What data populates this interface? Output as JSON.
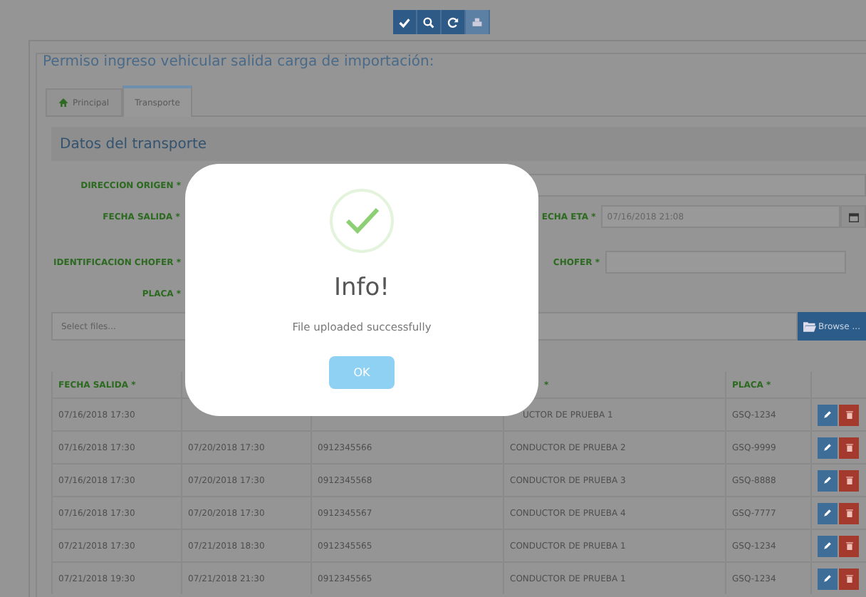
{
  "toolbar": [
    {
      "kind": "check",
      "disabled": false
    },
    {
      "kind": "search",
      "disabled": false
    },
    {
      "kind": "refresh",
      "disabled": false
    },
    {
      "kind": "print",
      "disabled": true
    }
  ],
  "title": "Permiso ingreso vehicular salida carga de importación:",
  "tabs": [
    {
      "label": "Principal",
      "kind": "home",
      "selected": false
    },
    {
      "label": "Transporte",
      "selected": true
    }
  ],
  "section_title": "Datos del transporte",
  "form": {
    "left_labels": [
      "DIRECCION ORIGEN *",
      "FECHA SALIDA *",
      "IDENTIFICACION CHOFER *",
      "PLACA *"
    ],
    "right_fields": [
      {
        "label": "ECHA ETA *",
        "value": "07/16/2018 21:08",
        "kind": "date"
      },
      {
        "label": "CHOFER *",
        "kind": "text"
      }
    ]
  },
  "upload": {
    "placeholder": "Select files...",
    "button": "Browse ..."
  },
  "table": {
    "columns": [
      {
        "label": "FECHA SALIDA *"
      },
      {},
      {},
      {
        "label": "*"
      },
      {
        "label": "PLACA *"
      },
      {}
    ],
    "rows": [
      {
        "cells": [
          "07/16/2018 17:30",
          null,
          null,
          "UCTOR DE PRUEBA 1",
          "GSQ-1234"
        ]
      },
      {
        "cells": [
          "07/16/2018 17:30",
          "07/20/2018 17:30",
          "0912345566",
          "CONDUCTOR DE PRUEBA 2",
          "GSQ-9999"
        ]
      },
      {
        "cells": [
          "07/16/2018 17:30",
          "07/20/2018 17:30",
          "0912345568",
          "CONDUCTOR DE PRUEBA 3",
          "GSQ-8888"
        ]
      },
      {
        "cells": [
          "07/16/2018 17:30",
          "07/20/2018 17:30",
          "0912345567",
          "CONDUCTOR DE PRUEBA 4",
          "GSQ-7777"
        ]
      },
      {
        "cells": [
          "07/21/2018 17:30",
          "07/21/2018 18:30",
          "0912345565",
          "CONDUCTOR DE PRUEBA 1",
          "GSQ-1234"
        ]
      },
      {
        "cells": [
          "07/21/2018 19:30",
          "07/21/2018 21:30",
          "0912345565",
          "CONDUCTOR DE PRUEBA 1",
          "GSQ-1234"
        ]
      }
    ]
  },
  "modal": {
    "kind": "success",
    "title": "Info!",
    "message": "File uploaded successfully",
    "button": "OK"
  }
}
